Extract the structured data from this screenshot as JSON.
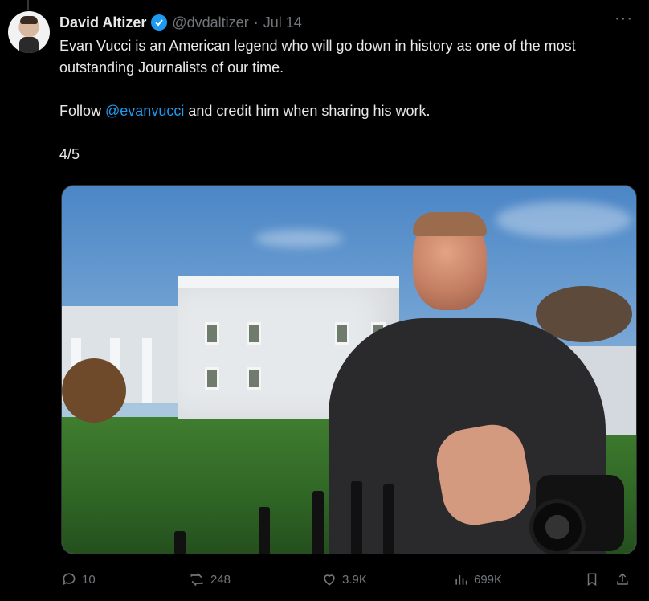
{
  "tweet": {
    "author_name": "David Altizer",
    "handle": "@dvdaltizer",
    "separator": "·",
    "date": "Jul 14",
    "more_label": "···",
    "text_line1": "Evan Vucci is an American legend who will go down in history as one of the most outstanding Journalists of our time.",
    "text_follow_prefix": "Follow ",
    "mention": "@evanvucci",
    "text_follow_suffix": " and credit him when sharing his work.",
    "counter": "4/5"
  },
  "actions": {
    "replies": "10",
    "reposts": "248",
    "likes": "3.9K",
    "views": "699K"
  },
  "colors": {
    "accent": "#1d9bf0",
    "muted": "#71767b",
    "background": "#000000"
  },
  "icons": [
    "reply-icon",
    "repost-icon",
    "like-icon",
    "views-icon",
    "bookmark-icon",
    "share-icon",
    "verified-badge-icon",
    "more-icon"
  ]
}
